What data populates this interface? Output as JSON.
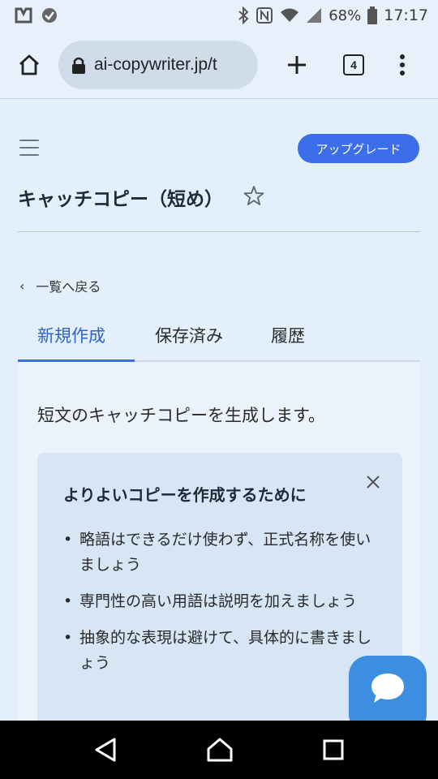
{
  "status_bar": {
    "battery": "68%",
    "time": "17:17"
  },
  "browser": {
    "url": "ai-copywriter.jp/t",
    "tab_count": "4"
  },
  "header": {
    "upgrade_label": "アップグレード",
    "title": "キャッチコピー（短め）"
  },
  "nav": {
    "back_label": "一覧へ戻る"
  },
  "tabs": [
    {
      "label": "新規作成",
      "active": true
    },
    {
      "label": "保存済み",
      "active": false
    },
    {
      "label": "履歴",
      "active": false
    }
  ],
  "main": {
    "intro": "短文のキャッチコピーを生成します。"
  },
  "tips": {
    "title": "よりよいコピーを作成するために",
    "items": [
      "略語はできるだけ使わず、正式名称を使いましょう",
      "専門性の高い用語は説明を加えましょう",
      "抽象的な表現は避けて、具体的に書きましょう"
    ]
  },
  "colors": {
    "accent": "#3b6ee8",
    "page_bg": "#e3f0fb",
    "tip_bg": "#d6e6f5",
    "chat_fab": "#3b8ee0"
  }
}
